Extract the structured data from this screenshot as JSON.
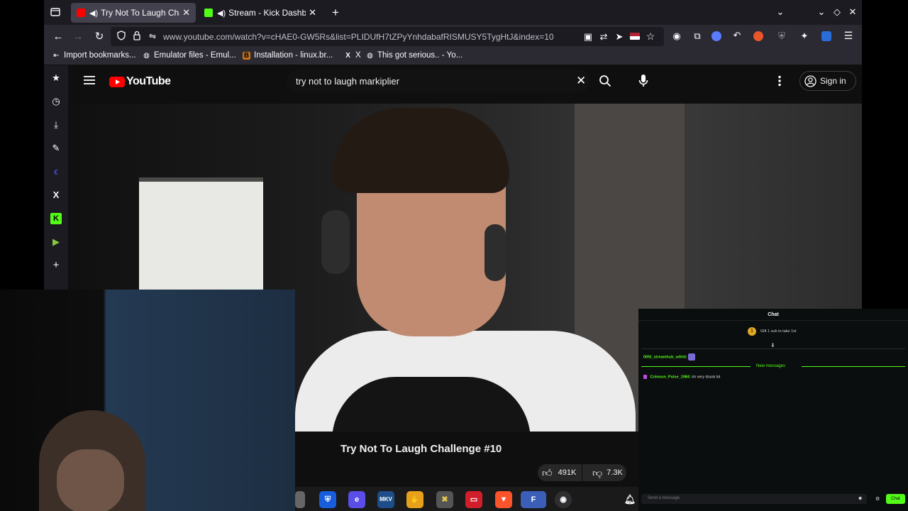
{
  "browser": {
    "tabs": [
      {
        "title": "Try Not To Laugh Chall",
        "active": true
      },
      {
        "title": "Stream - Kick Dashboar",
        "active": false
      }
    ],
    "new_tab_icon": "plus-icon",
    "url": "www.youtube.com/watch?v=cHAE0-GW5Rs&list=PLIDUfH7tZPyYnhdabafRISMUSY5TygHtJ&index=10",
    "bookmarks": [
      {
        "label": "Import bookmarks..."
      },
      {
        "label": "Emulator files - Emul..."
      },
      {
        "label": "Installation - linux.br..."
      },
      {
        "label": "X"
      },
      {
        "label": "This got serious.. - Yo..."
      }
    ]
  },
  "youtube": {
    "logo_text": "YouTube",
    "search_value": "try not to laugh markiplier",
    "sign_in_label": "Sign in",
    "video_title": "Try Not To Laugh Challenge #10",
    "likes": "491K",
    "dislikes": "7.3K"
  },
  "chat": {
    "header": "Chat",
    "gift_text": "Gift 1 sub to take 1st",
    "messages": [
      {
        "user": "00fd_streamhub_w0rld:",
        "text": ""
      },
      {
        "user": "Crimson_Pulse_1984:",
        "text": "im very drunk lol"
      }
    ],
    "new_messages_label": "New messages",
    "input_placeholder": "Send a message",
    "send_label": "Chat"
  },
  "colors": {
    "kick_green": "#53fc18",
    "youtube_red": "#ff0000",
    "firefox_tab_bg": "#1c1b22",
    "firefox_toolbar_bg": "#2b2a33"
  }
}
